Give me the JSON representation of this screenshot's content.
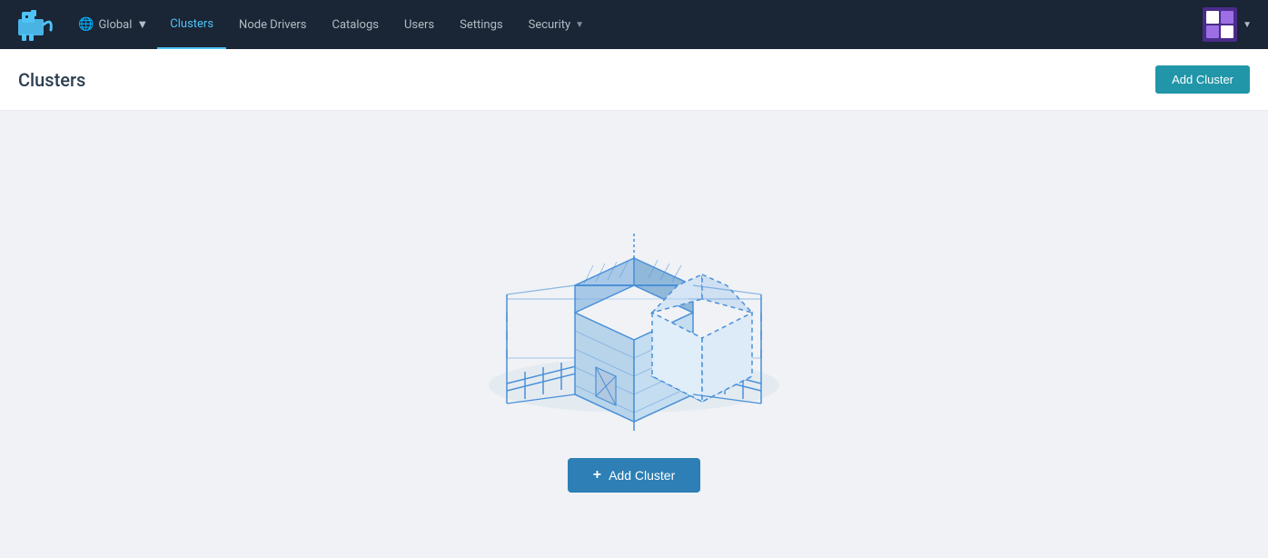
{
  "app": {
    "logo_alt": "Rancher logo"
  },
  "navbar": {
    "global_label": "Global",
    "nav_items": [
      {
        "id": "clusters",
        "label": "Clusters",
        "active": true
      },
      {
        "id": "node-drivers",
        "label": "Node Drivers",
        "active": false
      },
      {
        "id": "catalogs",
        "label": "Catalogs",
        "active": false
      },
      {
        "id": "users",
        "label": "Users",
        "active": false
      },
      {
        "id": "settings",
        "label": "Settings",
        "active": false
      },
      {
        "id": "security",
        "label": "Security",
        "active": false,
        "has_dropdown": true
      }
    ]
  },
  "page": {
    "title": "Clusters",
    "add_cluster_button": "Add Cluster",
    "add_cluster_center_button": "Add Cluster",
    "empty_state_alt": "No clusters illustration"
  }
}
